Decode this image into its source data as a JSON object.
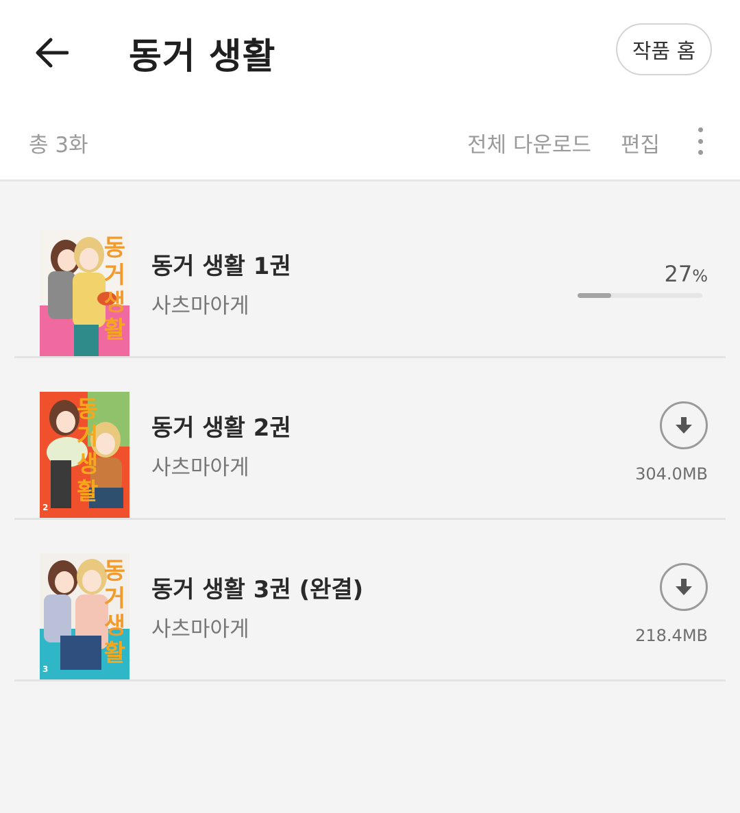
{
  "header": {
    "title": "동거 생활",
    "home_button": "작품 홈"
  },
  "toolbar": {
    "count": "총 3화",
    "download_all": "전체 다운로드",
    "edit": "편집"
  },
  "items": [
    {
      "title": "동거 생활 1권",
      "author": "사츠마아게",
      "status": "downloading",
      "percent_number": "27",
      "percent_sign": "%",
      "progress": 0.27,
      "cover_chars": [
        "동",
        "거",
        "생",
        "활"
      ],
      "cover_colors": [
        "#f06aa0",
        "#f6f2ee"
      ],
      "cover_icon": "cover-image-vol1"
    },
    {
      "title": "동거 생활 2권",
      "author": "사츠마아게",
      "status": "not_downloaded",
      "size": "304.0MB",
      "cover_chars": [
        "동",
        "거",
        "생",
        "활"
      ],
      "cover_colors": [
        "#f0502b",
        "#8fc26a"
      ],
      "cover_vol": "2",
      "cover_icon": "cover-image-vol2"
    },
    {
      "title": "동거 생활 3권 (완결)",
      "author": "사츠마아게",
      "status": "not_downloaded",
      "size": "218.4MB",
      "cover_chars": [
        "동",
        "거",
        "생",
        "활"
      ],
      "cover_colors": [
        "#2fb7c8",
        "#f3f0ec"
      ],
      "cover_vol": "3",
      "cover_icon": "cover-image-vol3"
    }
  ],
  "icons": {
    "back": "arrow-left-icon",
    "more": "more-vertical-icon",
    "download": "download-icon"
  },
  "colors": {
    "accent_text": "#1f1f1f",
    "muted_text": "#9a9a9a",
    "progress_fill": "#a3a3a3",
    "progress_track": "#e6e6e6",
    "background": "#f4f4f4"
  }
}
